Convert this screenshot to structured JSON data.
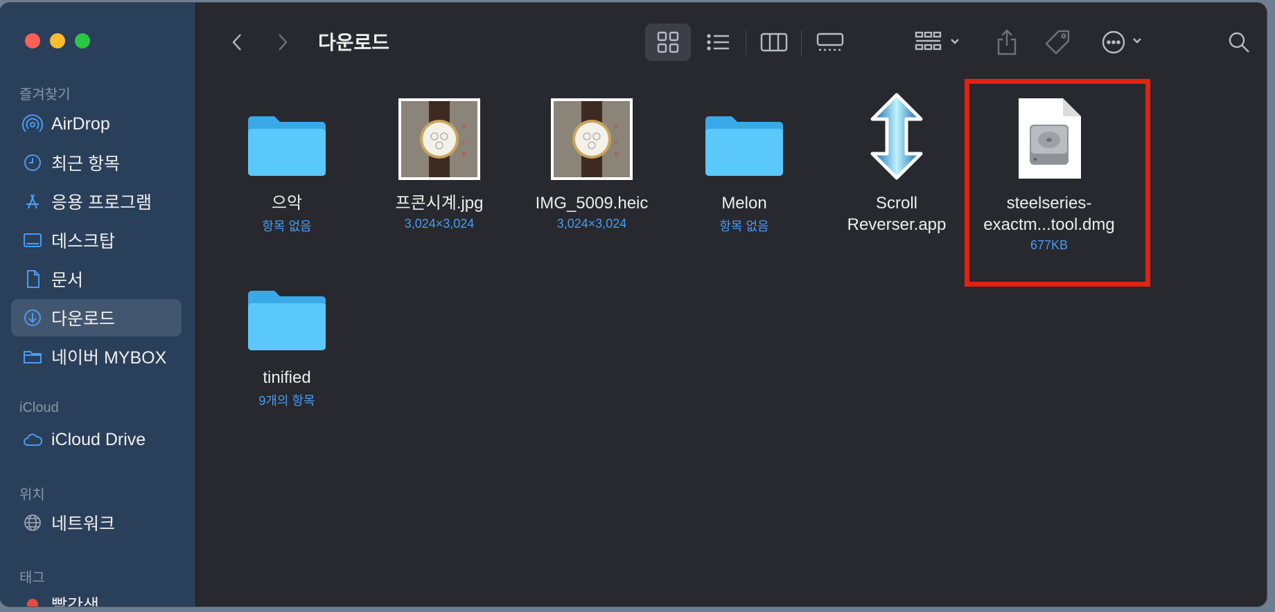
{
  "window": {
    "title": "다운로드"
  },
  "sidebar": {
    "sections": {
      "favorites": "즐겨찾기",
      "icloud": "iCloud",
      "locations": "위치",
      "tags": "태그"
    },
    "favorites": [
      {
        "label": "AirDrop",
        "icon": "airdrop-icon"
      },
      {
        "label": "최근 항목",
        "icon": "clock-icon"
      },
      {
        "label": "응용 프로그램",
        "icon": "applications-icon"
      },
      {
        "label": "데스크탑",
        "icon": "desktop-icon"
      },
      {
        "label": "문서",
        "icon": "document-icon"
      },
      {
        "label": "다운로드",
        "icon": "download-icon",
        "active": true
      },
      {
        "label": "네이버 MYBOX",
        "icon": "folder-icon"
      }
    ],
    "icloud": [
      {
        "label": "iCloud Drive",
        "icon": "cloud-icon"
      }
    ],
    "locations": [
      {
        "label": "네트워크",
        "icon": "network-icon"
      }
    ],
    "tags": [
      {
        "label": "빨간색",
        "color": "#e84a43"
      }
    ]
  },
  "toolbar": {
    "view_mode": "icon",
    "icons": [
      "back-icon",
      "forward-icon",
      "icon-view-icon",
      "list-view-icon",
      "column-view-icon",
      "gallery-view-icon",
      "group-icon",
      "share-icon",
      "tag-icon",
      "more-icon",
      "search-icon"
    ]
  },
  "files": [
    {
      "name": "으악",
      "meta": "항목 없음",
      "type": "folder"
    },
    {
      "name": "프콘시계.jpg",
      "meta": "3,024×3,024",
      "type": "image"
    },
    {
      "name": "IMG_5009.heic",
      "meta": "3,024×3,024",
      "type": "image"
    },
    {
      "name": "Melon",
      "meta": "항목 없음",
      "type": "folder"
    },
    {
      "name_line1": "Scroll",
      "name_line2": "Reverser.app",
      "type": "app"
    },
    {
      "name_line1": "steelseries-",
      "name_line2": "exactm...tool.dmg",
      "meta": "677KB",
      "type": "dmg",
      "highlighted": true
    },
    {
      "name": "tinified",
      "meta": "9개의 항목",
      "type": "folder"
    }
  ],
  "colors": {
    "sidebar_bg": "#2a3f5a",
    "content_bg": "#27292e",
    "accent": "#4b9cf3",
    "highlight": "#e4220f",
    "folder": "#5ac8fa"
  }
}
